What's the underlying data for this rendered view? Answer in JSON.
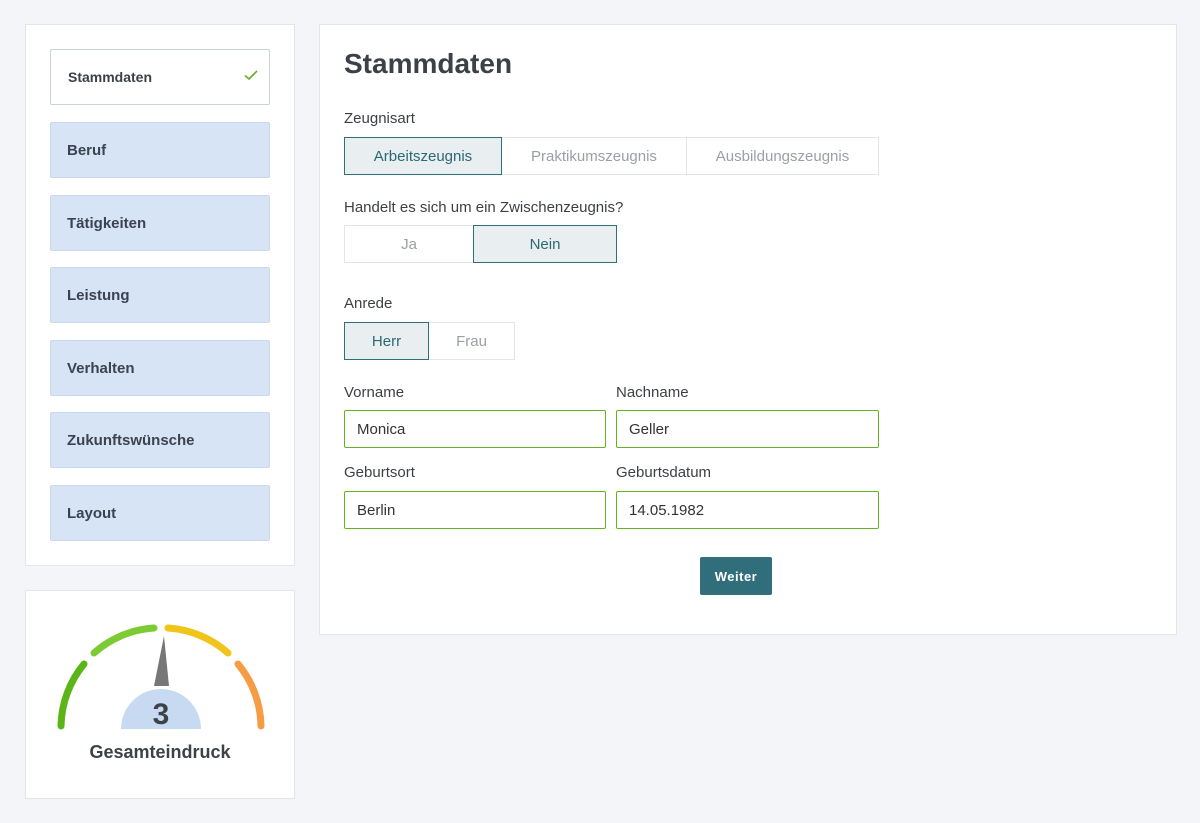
{
  "sidebar": {
    "items": [
      {
        "label": "Stammdaten",
        "active": true
      },
      {
        "label": "Beruf"
      },
      {
        "label": "Tätigkeiten"
      },
      {
        "label": "Leistung"
      },
      {
        "label": "Verhalten"
      },
      {
        "label": "Zukunftswünsche"
      },
      {
        "label": "Layout"
      }
    ]
  },
  "gauge": {
    "value": "3",
    "label": "Gesamteindruck",
    "colors": [
      "#5bb517",
      "#7dcb34",
      "#f0c419",
      "#f59c44"
    ]
  },
  "main": {
    "title": "Stammdaten",
    "zeugnisart": {
      "label": "Zeugnisart",
      "options": [
        "Arbeitszeugnis",
        "Praktikumszeugnis",
        "Ausbildungszeugnis"
      ],
      "selected": "Arbeitszeugnis"
    },
    "zwischenzeugnis": {
      "label": "Handelt es sich um ein Zwischenzeugnis?",
      "options": [
        "Ja",
        "Nein"
      ],
      "selected": "Nein"
    },
    "anrede": {
      "label": "Anrede",
      "options": [
        "Herr",
        "Frau"
      ],
      "selected": "Herr"
    },
    "vorname": {
      "label": "Vorname",
      "value": "Monica"
    },
    "nachname": {
      "label": "Nachname",
      "value": "Geller"
    },
    "geburtsort": {
      "label": "Geburtsort",
      "value": "Berlin"
    },
    "geburtsdatum": {
      "label": "Geburtsdatum",
      "value": "14.05.1982"
    },
    "next_label": "Weiter"
  },
  "colors": {
    "accent": "#2f6e7a",
    "valid_border": "#67b022",
    "step_bg": "#d6e4f5"
  }
}
